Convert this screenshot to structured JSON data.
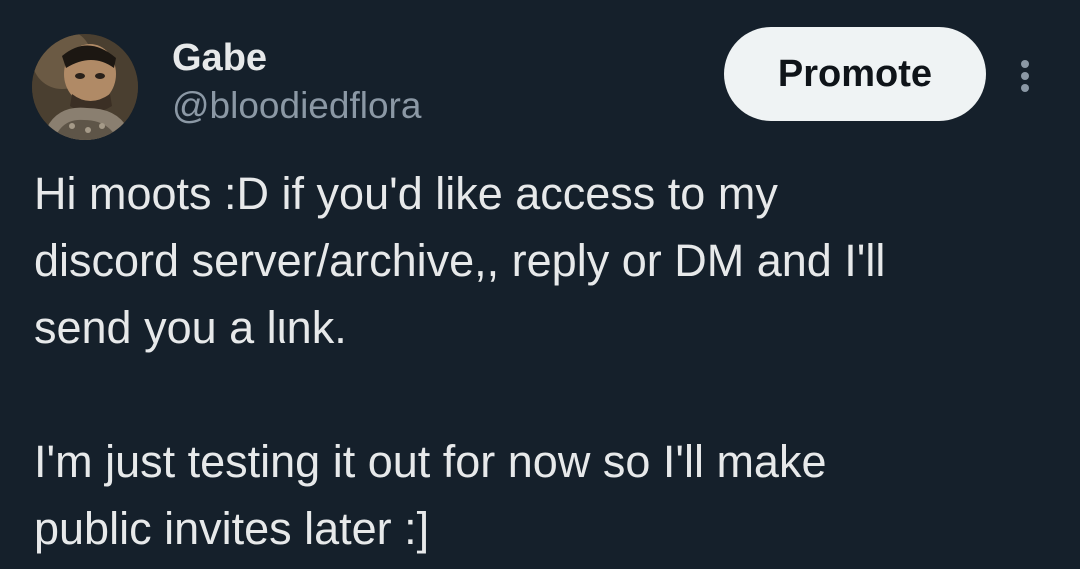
{
  "author": {
    "display_name": "Gabe",
    "handle": "@bloodiedflora",
    "avatar_icon": "user-avatar"
  },
  "actions": {
    "promote_label": "Promote",
    "more_icon": "more-vertical-icon"
  },
  "tweet": {
    "lines": [
      "Hi moots :D if you'd like access to my",
      "discord server/archive,, reply or DM and I'll",
      "send you a lιnk.",
      "",
      "I'm just testing it out for now so I'll make",
      "public invites later :]"
    ]
  },
  "colors": {
    "background": "#15202b",
    "text_primary": "#e7e9ea",
    "text_secondary": "#8b98a5",
    "button_bg": "#eff3f4",
    "button_text": "#0f1419"
  }
}
